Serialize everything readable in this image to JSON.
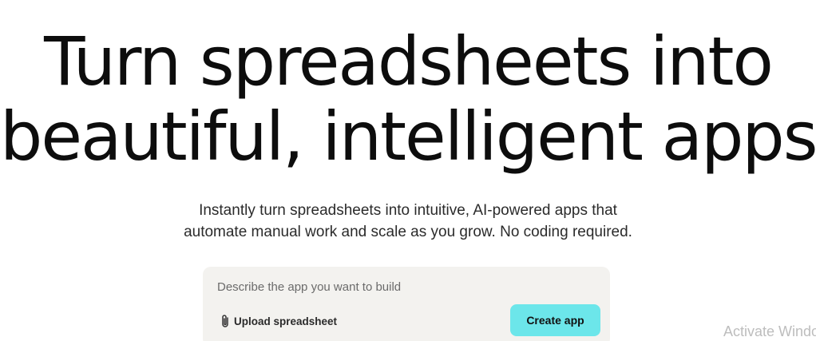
{
  "hero": {
    "title_line1": "Turn spreadsheets into",
    "title_line2": "beautiful, intelligent apps",
    "subtitle_line1": "Instantly turn spreadsheets into intuitive, AI-powered apps that",
    "subtitle_line2": "automate manual work and scale as you grow. No coding required."
  },
  "prompt": {
    "placeholder": "Describe the app you want to build",
    "value": "",
    "upload_label": "Upload spreadsheet",
    "upload_icon": "paperclip-icon",
    "create_label": "Create app"
  },
  "colors": {
    "accent": "#6ce6ea",
    "card_background": "#f3f2ef"
  },
  "system": {
    "watermark": "Activate Windows"
  }
}
